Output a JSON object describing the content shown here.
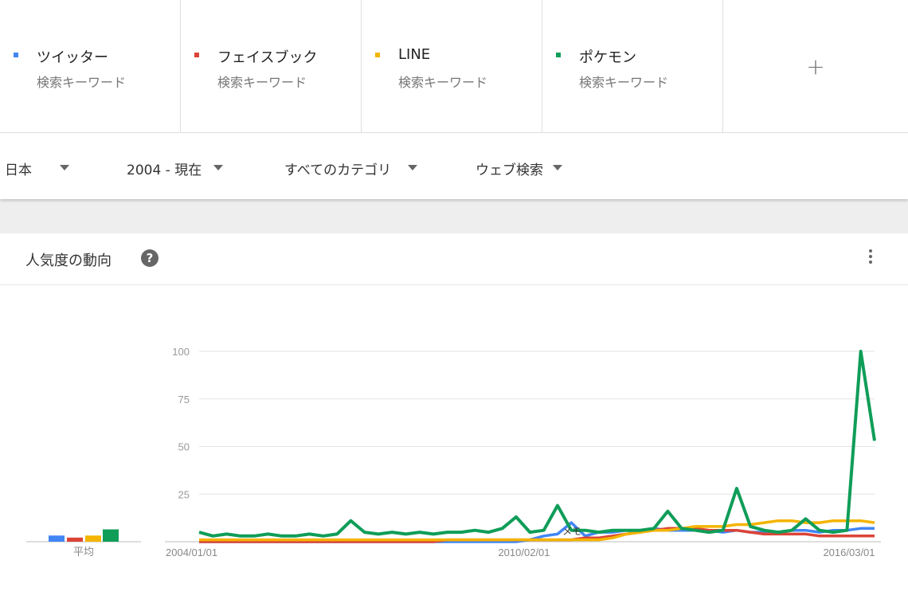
{
  "terms": [
    {
      "name": "ツイッター",
      "sub": "検索キーワード",
      "color": "#4285f4"
    },
    {
      "name": "フェイスブック",
      "sub": "検索キーワード",
      "color": "#db4437"
    },
    {
      "name": "LINE",
      "sub": "検索キーワード",
      "color": "#f4b400"
    },
    {
      "name": "ポケモン",
      "sub": "検索キーワード",
      "color": "#0f9d58"
    }
  ],
  "add_label": "+",
  "filters": {
    "region": "日本",
    "period": "2004 - 現在",
    "category": "すべてのカテゴリ",
    "search_type": "ウェブ検索"
  },
  "card": {
    "title": "人気度の動向",
    "help_icon": "?"
  },
  "chart_data": {
    "type": "line",
    "x": [
      "2004-01",
      "2004-04",
      "2004-07",
      "2004-10",
      "2005-01",
      "2005-04",
      "2005-07",
      "2005-10",
      "2006-01",
      "2006-04",
      "2006-07",
      "2006-10",
      "2007-01",
      "2007-04",
      "2007-07",
      "2007-10",
      "2008-01",
      "2008-04",
      "2008-07",
      "2008-10",
      "2009-01",
      "2009-04",
      "2009-07",
      "2009-10",
      "2010-01",
      "2010-04",
      "2010-07",
      "2010-10",
      "2011-01",
      "2011-04",
      "2011-07",
      "2011-10",
      "2012-01",
      "2012-04",
      "2012-07",
      "2012-10",
      "2013-01",
      "2013-04",
      "2013-07",
      "2013-10",
      "2014-01",
      "2014-04",
      "2014-07",
      "2014-10",
      "2015-01",
      "2015-04",
      "2015-07",
      "2015-10",
      "2016-01",
      "2016-03"
    ],
    "series": [
      {
        "name": "ツイッター",
        "color": "#4285f4",
        "values": [
          0,
          0,
          0,
          0,
          0,
          0,
          0,
          0,
          0,
          0,
          0,
          0,
          0,
          0,
          0,
          0,
          0,
          0,
          0,
          0,
          0,
          0,
          0,
          0,
          1,
          3,
          4,
          10,
          3,
          5,
          5,
          6,
          5,
          7,
          6,
          6,
          6,
          6,
          5,
          6,
          5,
          5,
          5,
          6,
          6,
          5,
          6,
          6,
          7,
          7
        ]
      },
      {
        "name": "フェイスブック",
        "color": "#db4437",
        "values": [
          0,
          0,
          0,
          0,
          0,
          0,
          0,
          0,
          0,
          0,
          0,
          0,
          0,
          0,
          0,
          0,
          0,
          0,
          1,
          1,
          1,
          1,
          1,
          1,
          1,
          1,
          1,
          1,
          2,
          2,
          3,
          4,
          5,
          6,
          7,
          7,
          7,
          6,
          6,
          6,
          5,
          4,
          4,
          4,
          4,
          3,
          3,
          3,
          3,
          3
        ]
      },
      {
        "name": "LINE",
        "color": "#f4b400",
        "values": [
          1,
          1,
          1,
          1,
          1,
          1,
          1,
          1,
          1,
          1,
          1,
          1,
          1,
          1,
          1,
          1,
          1,
          1,
          1,
          1,
          1,
          1,
          1,
          1,
          1,
          1,
          1,
          1,
          1,
          1,
          2,
          4,
          5,
          6,
          6,
          7,
          8,
          8,
          8,
          9,
          9,
          10,
          11,
          11,
          10,
          10,
          11,
          11,
          11,
          10
        ]
      },
      {
        "name": "ポケモン",
        "color": "#0f9d58",
        "values": [
          5,
          3,
          4,
          3,
          3,
          4,
          3,
          3,
          4,
          3,
          4,
          11,
          5,
          4,
          5,
          4,
          5,
          4,
          5,
          5,
          6,
          5,
          7,
          13,
          5,
          6,
          19,
          6,
          6,
          5,
          6,
          6,
          6,
          7,
          16,
          7,
          6,
          5,
          6,
          28,
          8,
          6,
          5,
          6,
          12,
          6,
          5,
          6,
          100,
          53
        ]
      }
    ],
    "ylim": [
      0,
      100
    ],
    "yticks": [
      25,
      50,
      75,
      100
    ],
    "xtick_labels": [
      "2004/01/01",
      "2010/02/01",
      "2016/03/01"
    ],
    "annotation": "メモ",
    "average": {
      "label": "平均",
      "values": [
        3,
        2,
        3,
        6
      ]
    },
    "grid": true
  }
}
